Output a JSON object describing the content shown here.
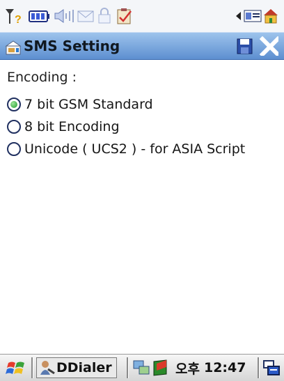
{
  "window": {
    "title": "SMS Setting"
  },
  "content": {
    "encoding_label": "Encoding :",
    "options": [
      {
        "label": "7 bit GSM Standard",
        "checked": true
      },
      {
        "label": "8 bit Encoding",
        "checked": false
      },
      {
        "label": "Unicode ( UCS2 ) - for ASIA Script",
        "checked": false
      }
    ]
  },
  "taskbar": {
    "app_label": "DDialer",
    "ampm": "오후",
    "time": "12:47"
  },
  "colors": {
    "titlebar": "#7aa9e0",
    "radio_selected": "#2aa436"
  },
  "icons": {
    "status": [
      "signal-icon",
      "battery-icon",
      "speaker-icon",
      "message-icon",
      "lock-icon",
      "notes-icon",
      "volume-icon",
      "contacts-icon"
    ],
    "title": "sms-settings-icon",
    "titlebar_buttons": [
      "save-icon",
      "close-icon"
    ],
    "taskbar": [
      "start-icon",
      "ddialer-icon",
      "network-icon",
      "app-icon",
      "input-panel-icon"
    ]
  }
}
